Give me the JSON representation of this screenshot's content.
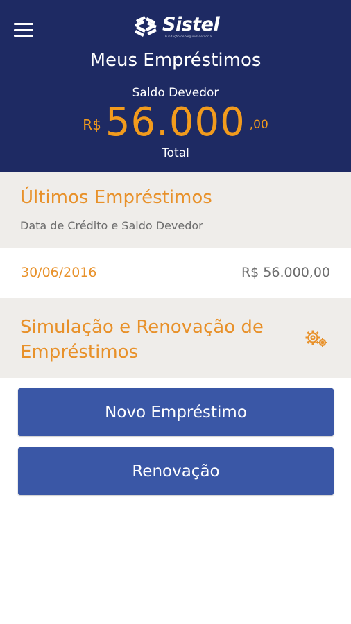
{
  "header": {
    "logo_text": "Sistel",
    "logo_tagline": "Fundação de Seguridade Social",
    "title": "Meus Empréstimos",
    "balance_label": "Saldo Devedor",
    "balance_currency": "R$",
    "balance_amount": "56.000",
    "balance_cents": ",00",
    "balance_total_label": "Total"
  },
  "last_loans": {
    "title": "Últimos Empréstimos",
    "subtitle": "Data de Crédito e Saldo Devedor",
    "rows": [
      {
        "date": "30/06/2016",
        "value": "R$ 56.000,00"
      }
    ]
  },
  "simulation": {
    "title": "Simulação e Renovação de Empréstimos",
    "icon": "gear-icon"
  },
  "actions": {
    "new_loan": "Novo Empréstimo",
    "renewal": "Renovação"
  },
  "colors": {
    "header_bg": "#1e2a63",
    "accent_orange": "#e8912a",
    "button_blue": "#3a57a6",
    "section_bg": "#efedea"
  }
}
